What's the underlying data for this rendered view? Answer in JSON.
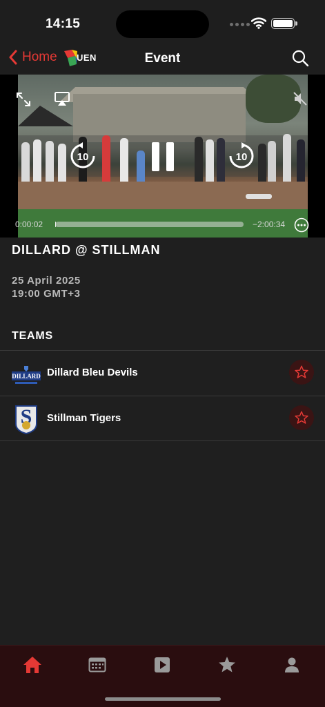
{
  "status_bar": {
    "time": "14:15"
  },
  "nav": {
    "back_label": "Home",
    "title": "Event",
    "logo_text": "UEN"
  },
  "video": {
    "elapsed": "0:00:02",
    "remaining": "−2:00:34",
    "progress": 0.0003,
    "skip_seconds": "10"
  },
  "event": {
    "title": "DILLARD @ STILLMAN",
    "date": "25 April 2025",
    "time": "19:00 GMT+3"
  },
  "teams_heading": "TEAMS",
  "teams": [
    {
      "name": "Dillard Bleu Devils",
      "logo_text": "DILLARD"
    },
    {
      "name": "Stillman Tigers",
      "logo_text": "S"
    }
  ],
  "tabs": [
    {
      "name": "home",
      "icon": "home-icon",
      "active": true
    },
    {
      "name": "schedule",
      "icon": "calendar-icon",
      "active": false
    },
    {
      "name": "videos",
      "icon": "play-icon",
      "active": false
    },
    {
      "name": "favorites",
      "icon": "star-icon",
      "active": false
    },
    {
      "name": "profile",
      "icon": "person-icon",
      "active": false
    }
  ],
  "colors": {
    "accent": "#e53935",
    "background": "#1f1f1f",
    "tab_bar": "#2a0d0f",
    "inactive_tab": "#9a9a9a"
  }
}
